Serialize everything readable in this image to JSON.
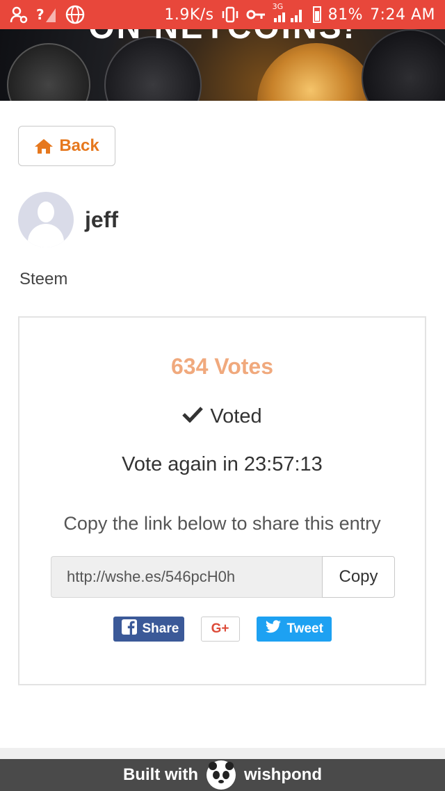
{
  "status_bar": {
    "network_speed": "1.9K/s",
    "network_type": "3G",
    "battery": "81%",
    "time": "7:24 AM",
    "icons": [
      "person-settings-icon",
      "signal-unknown-icon",
      "vpn-globe-icon",
      "vibrate-icon",
      "key-icon",
      "signal-icon",
      "battery-icon"
    ]
  },
  "hero": {
    "title": "ON NETCOINS!"
  },
  "nav": {
    "back_label": "Back",
    "back_icon": "home-icon",
    "accent_color": "#e6781e"
  },
  "entry": {
    "author": "jeff",
    "category": "Steem"
  },
  "vote_card": {
    "votes": "634 Votes",
    "voted_label": "Voted",
    "vote_again": "Vote again in 23:57:13",
    "copy_hint": "Copy the link below to share this entry",
    "share_link": "http://wshe.es/546pcH0h",
    "copy_label": "Copy",
    "votes_color": "#f0a97d"
  },
  "share": {
    "facebook_label": "Share",
    "gplus_label": "G+",
    "twitter_label": "Tweet",
    "facebook_color": "#3b5998",
    "twitter_color": "#1da1f2"
  },
  "footer": {
    "built_with": "Built with",
    "brand": "wishpond"
  }
}
